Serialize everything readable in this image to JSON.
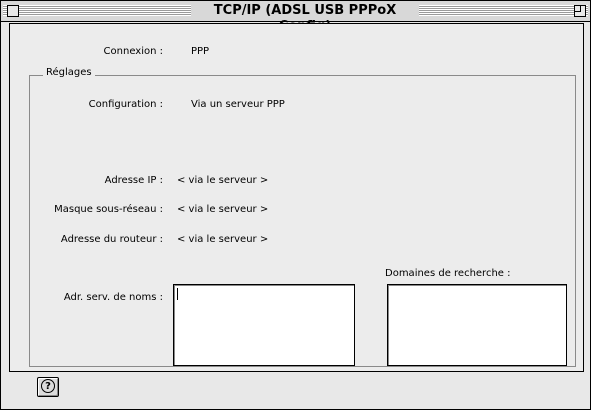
{
  "window": {
    "title": "TCP/IP (ADSL USB PPPoX Config)"
  },
  "connexion": {
    "label": "Connexion :",
    "value": "PPP"
  },
  "reglages": {
    "title": "Réglages",
    "configuration": {
      "label": "Configuration :",
      "value": "Via un serveur PPP"
    },
    "adresse_ip": {
      "label": "Adresse IP :",
      "value": "< via le serveur >"
    },
    "masque": {
      "label": "Masque sous-réseau :",
      "value": "< via le serveur >"
    },
    "routeur": {
      "label": "Adresse du routeur :",
      "value": "< via le serveur >"
    },
    "serveurs_noms": {
      "label": "Adr. serv. de noms :",
      "value": ""
    },
    "domaines": {
      "label": "Domaines de recherche :",
      "value": ""
    }
  },
  "help": {
    "glyph": "?",
    "icon": "help-icon"
  }
}
